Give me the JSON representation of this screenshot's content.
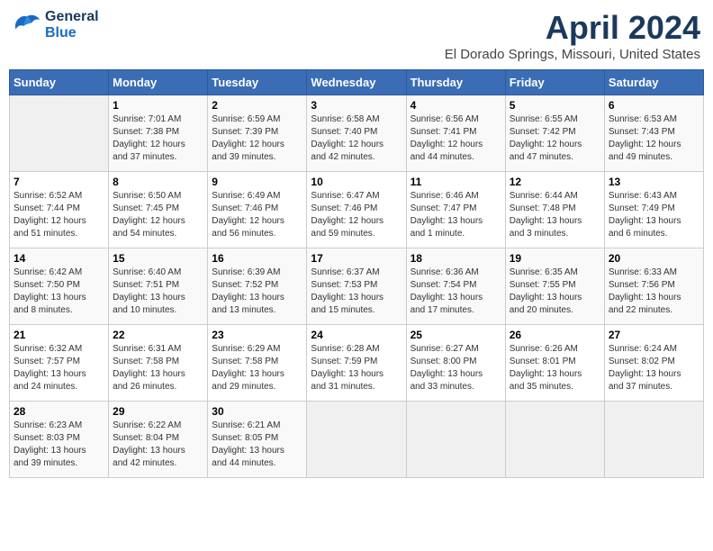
{
  "header": {
    "logo_line1": "General",
    "logo_line2": "Blue",
    "month": "April 2024",
    "location": "El Dorado Springs, Missouri, United States"
  },
  "days_of_week": [
    "Sunday",
    "Monday",
    "Tuesday",
    "Wednesday",
    "Thursday",
    "Friday",
    "Saturday"
  ],
  "weeks": [
    [
      {
        "num": "",
        "info": ""
      },
      {
        "num": "1",
        "info": "Sunrise: 7:01 AM\nSunset: 7:38 PM\nDaylight: 12 hours\nand 37 minutes."
      },
      {
        "num": "2",
        "info": "Sunrise: 6:59 AM\nSunset: 7:39 PM\nDaylight: 12 hours\nand 39 minutes."
      },
      {
        "num": "3",
        "info": "Sunrise: 6:58 AM\nSunset: 7:40 PM\nDaylight: 12 hours\nand 42 minutes."
      },
      {
        "num": "4",
        "info": "Sunrise: 6:56 AM\nSunset: 7:41 PM\nDaylight: 12 hours\nand 44 minutes."
      },
      {
        "num": "5",
        "info": "Sunrise: 6:55 AM\nSunset: 7:42 PM\nDaylight: 12 hours\nand 47 minutes."
      },
      {
        "num": "6",
        "info": "Sunrise: 6:53 AM\nSunset: 7:43 PM\nDaylight: 12 hours\nand 49 minutes."
      }
    ],
    [
      {
        "num": "7",
        "info": "Sunrise: 6:52 AM\nSunset: 7:44 PM\nDaylight: 12 hours\nand 51 minutes."
      },
      {
        "num": "8",
        "info": "Sunrise: 6:50 AM\nSunset: 7:45 PM\nDaylight: 12 hours\nand 54 minutes."
      },
      {
        "num": "9",
        "info": "Sunrise: 6:49 AM\nSunset: 7:46 PM\nDaylight: 12 hours\nand 56 minutes."
      },
      {
        "num": "10",
        "info": "Sunrise: 6:47 AM\nSunset: 7:46 PM\nDaylight: 12 hours\nand 59 minutes."
      },
      {
        "num": "11",
        "info": "Sunrise: 6:46 AM\nSunset: 7:47 PM\nDaylight: 13 hours\nand 1 minute."
      },
      {
        "num": "12",
        "info": "Sunrise: 6:44 AM\nSunset: 7:48 PM\nDaylight: 13 hours\nand 3 minutes."
      },
      {
        "num": "13",
        "info": "Sunrise: 6:43 AM\nSunset: 7:49 PM\nDaylight: 13 hours\nand 6 minutes."
      }
    ],
    [
      {
        "num": "14",
        "info": "Sunrise: 6:42 AM\nSunset: 7:50 PM\nDaylight: 13 hours\nand 8 minutes."
      },
      {
        "num": "15",
        "info": "Sunrise: 6:40 AM\nSunset: 7:51 PM\nDaylight: 13 hours\nand 10 minutes."
      },
      {
        "num": "16",
        "info": "Sunrise: 6:39 AM\nSunset: 7:52 PM\nDaylight: 13 hours\nand 13 minutes."
      },
      {
        "num": "17",
        "info": "Sunrise: 6:37 AM\nSunset: 7:53 PM\nDaylight: 13 hours\nand 15 minutes."
      },
      {
        "num": "18",
        "info": "Sunrise: 6:36 AM\nSunset: 7:54 PM\nDaylight: 13 hours\nand 17 minutes."
      },
      {
        "num": "19",
        "info": "Sunrise: 6:35 AM\nSunset: 7:55 PM\nDaylight: 13 hours\nand 20 minutes."
      },
      {
        "num": "20",
        "info": "Sunrise: 6:33 AM\nSunset: 7:56 PM\nDaylight: 13 hours\nand 22 minutes."
      }
    ],
    [
      {
        "num": "21",
        "info": "Sunrise: 6:32 AM\nSunset: 7:57 PM\nDaylight: 13 hours\nand 24 minutes."
      },
      {
        "num": "22",
        "info": "Sunrise: 6:31 AM\nSunset: 7:58 PM\nDaylight: 13 hours\nand 26 minutes."
      },
      {
        "num": "23",
        "info": "Sunrise: 6:29 AM\nSunset: 7:58 PM\nDaylight: 13 hours\nand 29 minutes."
      },
      {
        "num": "24",
        "info": "Sunrise: 6:28 AM\nSunset: 7:59 PM\nDaylight: 13 hours\nand 31 minutes."
      },
      {
        "num": "25",
        "info": "Sunrise: 6:27 AM\nSunset: 8:00 PM\nDaylight: 13 hours\nand 33 minutes."
      },
      {
        "num": "26",
        "info": "Sunrise: 6:26 AM\nSunset: 8:01 PM\nDaylight: 13 hours\nand 35 minutes."
      },
      {
        "num": "27",
        "info": "Sunrise: 6:24 AM\nSunset: 8:02 PM\nDaylight: 13 hours\nand 37 minutes."
      }
    ],
    [
      {
        "num": "28",
        "info": "Sunrise: 6:23 AM\nSunset: 8:03 PM\nDaylight: 13 hours\nand 39 minutes."
      },
      {
        "num": "29",
        "info": "Sunrise: 6:22 AM\nSunset: 8:04 PM\nDaylight: 13 hours\nand 42 minutes."
      },
      {
        "num": "30",
        "info": "Sunrise: 6:21 AM\nSunset: 8:05 PM\nDaylight: 13 hours\nand 44 minutes."
      },
      {
        "num": "",
        "info": ""
      },
      {
        "num": "",
        "info": ""
      },
      {
        "num": "",
        "info": ""
      },
      {
        "num": "",
        "info": ""
      }
    ]
  ]
}
